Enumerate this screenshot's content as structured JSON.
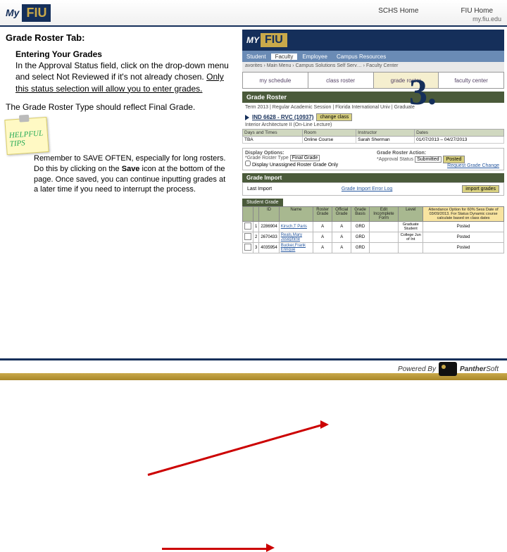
{
  "header": {
    "logo_my": "My",
    "logo_fiu": "FIU",
    "link1": "SCHS Home",
    "link2": "FIU Home",
    "url": "my.fiu.edu"
  },
  "left": {
    "section_title": "Grade Roster Tab:",
    "heading": "Entering Your Grades",
    "p1a": "In the Approval Status field, click on the drop-down menu and select Not Reviewed if it's not already chosen. ",
    "p1b": "Only this status selection will allow you to enter grades.",
    "p2": "The Grade Roster Type should reflect Final Grade.",
    "tips_label": "HELPFUL TIPS",
    "tip_a": "Remember to SAVE OFTEN, especially for long rosters. Do this by clicking on the ",
    "tip_b": "Save",
    "tip_c": " icon at the bottom of the page. Once saved, you can continue inputting grades at a later time if you need to interrupt the process."
  },
  "right": {
    "banner_my": "MY",
    "banner_fiu": "FIU",
    "tabs": [
      "Student",
      "Faculty",
      "Employee",
      "Campus Resources"
    ],
    "crumbs": "avorites  ›  Main Menu  ›  Campus Solutions Self Serv…  ›  Faculty Center",
    "subnav": [
      "my schedule",
      "class roster",
      "grade roster",
      "faculty center"
    ],
    "gr_title": "Grade Roster",
    "term": "Term 2013 | Regular Academic Session | Florida International Univ | Graduate",
    "class_code": "IND 6628 - RVC (10937)",
    "change_class": "change class",
    "course_title": "Interior Architecture II (On-Line Lecture)",
    "sched": {
      "h1": "Days and Times",
      "h2": "Room",
      "h3": "Instructor",
      "h4": "Dates",
      "v1": "TBA",
      "v2": "Online Course",
      "v3": "Sarah Sherman",
      "v4": "01/07/2013 – 04/27/2013"
    },
    "disp": {
      "title_l": "Display Options:",
      "title_r": "Grade Roster Action:",
      "grt_label": "*Grade Roster Type",
      "grt_value": "Final Grade",
      "unassigned": "Display Unassigned Roster Grade Only",
      "as_label": "*Approval Status",
      "as_value": "Submitted",
      "posted": "Posted",
      "req": "Request Grade Change"
    },
    "gi": {
      "header": "Grade Import",
      "last": "Last Import",
      "log": "Grade Import Error Log",
      "btn": "import grades"
    },
    "sg_tab": "Student Grade",
    "roster": {
      "headers": [
        "",
        "",
        "ID",
        "Name",
        "Roster Grade",
        "Official Grade",
        "Grade Basis",
        "Edit Incomplete Form",
        "Level",
        "Attendance Option for 60% Sess Date of 03/09/2013. For Status Dynamic course calculate based on class dates"
      ],
      "rows": [
        {
          "n": "1",
          "id": "2286904",
          "name": "Kirsch,T Paris",
          "rg": "A",
          "og": "A",
          "gb": "GRD",
          "lvl": "Graduate Student",
          "att": "Posted"
        },
        {
          "n": "2",
          "id": "2670433",
          "name": "Reals,Mary Josephine",
          "rg": "A",
          "og": "A",
          "gb": "GRD",
          "lvl": "College Jun of Int",
          "att": "Posted"
        },
        {
          "n": "3",
          "id": "4035954",
          "name": "Bucker,Frank Enrique",
          "rg": "A",
          "og": "A",
          "gb": "GRD",
          "lvl": "",
          "att": "Posted"
        }
      ]
    }
  },
  "overlay": {
    "step": "3."
  },
  "footer": {
    "powered": "Powered By",
    "brand": "Panther",
    "soft": "Soft"
  }
}
